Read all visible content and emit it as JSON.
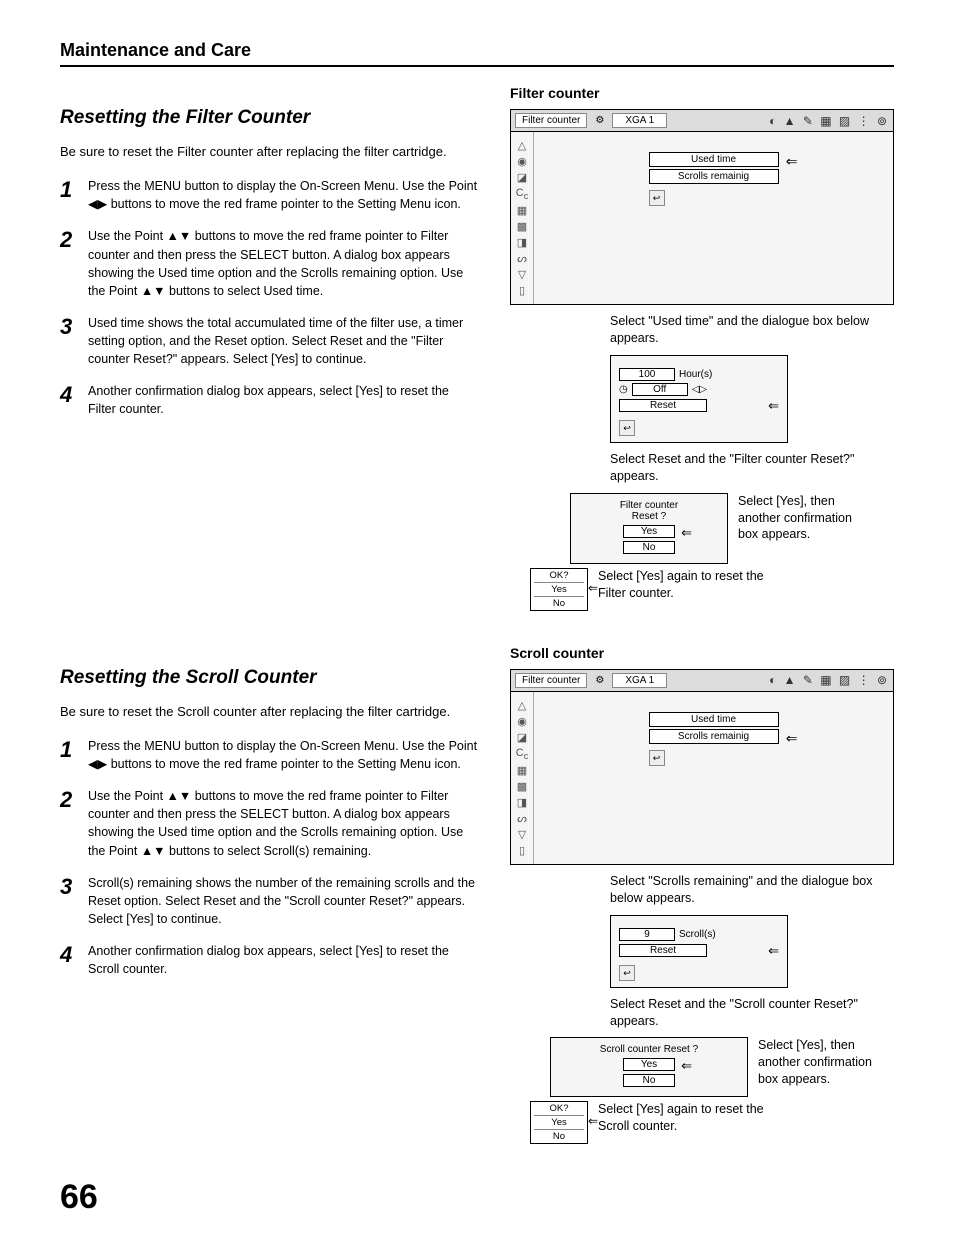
{
  "header": "Maintenance and Care",
  "page_number": "66",
  "filter": {
    "title": "Resetting the Filter Counter",
    "intro": "Be sure to reset the Filter counter after replacing the filter cartridge.",
    "steps": [
      "Press the MENU button to display the On-Screen Menu. Use the Point ◀▶ buttons to move the red frame pointer to the Setting Menu icon.",
      "Use the Point ▲▼ buttons to move the red frame pointer to Filter counter and then press the SELECT button. A dialog box appears showing the Used time option and the Scrolls remaining option. Use the Point ▲▼ buttons to select Used time.",
      "Used time shows the total accumulated time of the filter use, a timer setting option, and the Reset option. Select Reset and the \"Filter counter Reset?\" appears. Select [Yes] to continue.",
      "Another confirmation dialog box appears, select [Yes] to reset the Filter counter."
    ],
    "right_title": "Filter counter",
    "osd": {
      "label": "Filter counter",
      "mode": "XGA 1",
      "row1": "Used time",
      "row2": "Scrolls remainig"
    },
    "cap1": "Select \"Used time\" and the dialogue box below appears.",
    "sub": {
      "hours_val": "100",
      "hours_unit": "Hour(s)",
      "timer": "Off",
      "reset": "Reset"
    },
    "cap2": "Select Reset and the \"Filter counter Reset?\" appears.",
    "dialog1": {
      "title1": "Filter counter",
      "title2": "Reset ?",
      "yes": "Yes",
      "no": "No"
    },
    "side_cap1": "Select [Yes], then another confirmation box appears.",
    "dialog2": {
      "ok": "OK?",
      "yes": "Yes",
      "no": "No"
    },
    "cap3": "Select [Yes] again to reset the Filter counter."
  },
  "scroll": {
    "title": "Resetting the Scroll Counter",
    "intro": "Be sure to reset the Scroll counter after replacing the filter cartridge.",
    "steps": [
      "Press the MENU button to display the On-Screen Menu. Use the Point ◀▶ buttons to move the red frame pointer to the Setting Menu icon.",
      "Use the Point ▲▼ buttons to move the red frame pointer to Filter counter and then press the SELECT button. A dialog box appears showing the Used time option and the Scrolls remaining option. Use the Point ▲▼ buttons to select Scroll(s) remaining.",
      "Scroll(s) remaining shows the number of the remaining scrolls and the Reset option. Select Reset and the \"Scroll counter Reset?\" appears. Select [Yes] to continue.",
      "Another confirmation dialog box appears, select [Yes] to reset the Scroll counter."
    ],
    "right_title": "Scroll counter",
    "osd": {
      "label": "Filter counter",
      "mode": "XGA 1",
      "row1": "Used time",
      "row2": "Scrolls remainig"
    },
    "cap1": "Select \"Scrolls remaining\" and the dialogue box below appears.",
    "sub": {
      "val": "9",
      "unit": "Scroll(s)",
      "reset": "Reset"
    },
    "cap2": "Select Reset and the \"Scroll counter Reset?\" appears.",
    "dialog1": {
      "title": "Scroll counter Reset ?",
      "yes": "Yes",
      "no": "No"
    },
    "side_cap1": "Select [Yes], then another confirmation box appears.",
    "dialog2": {
      "ok": "OK?",
      "yes": "Yes",
      "no": "No"
    },
    "cap3": "Select [Yes] again to reset the Scroll counter."
  }
}
